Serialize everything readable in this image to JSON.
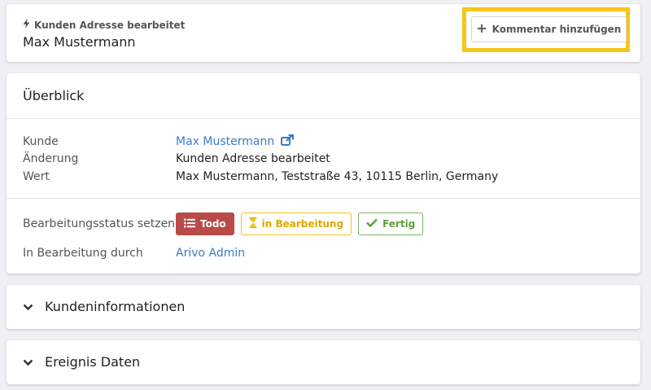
{
  "header": {
    "subtitle": "Kunden Adresse bearbeitet",
    "title": "Max Mustermann",
    "comment_button": "Kommentar hinzufügen"
  },
  "overview": {
    "title": "Überblick",
    "rows": [
      {
        "label": "Kunde",
        "value": "Max Mustermann"
      },
      {
        "label": "Änderung",
        "value": "Kunden Adresse bearbeitet"
      },
      {
        "label": "Wert",
        "value": "Max Mustermann, Teststraße 43, 10115 Berlin, Germany"
      }
    ],
    "status_label": "Bearbeitungsstatus setzen",
    "status_buttons": {
      "todo": "Todo",
      "in_progress": "in Bearbeitung",
      "done": "Fertig"
    },
    "assigned_label": "In Bearbeitung durch",
    "assigned_value": "Arivo Admin"
  },
  "sections": [
    {
      "label": "Kundeninformationen"
    },
    {
      "label": "Ereignis Daten"
    }
  ],
  "colors": {
    "link": "#3a7bc8",
    "todo": "#b94a48",
    "in_progress": "#f0c419",
    "done": "#5aa13c",
    "highlight": "#f5c518"
  },
  "icons": {
    "subtitle": "bolt-icon",
    "comment": "plus-icon",
    "customer_link": "external-link-icon",
    "todo": "list-icon",
    "in_progress": "hourglass-icon",
    "done": "check-icon",
    "section_toggle": "chevron-down-icon"
  }
}
